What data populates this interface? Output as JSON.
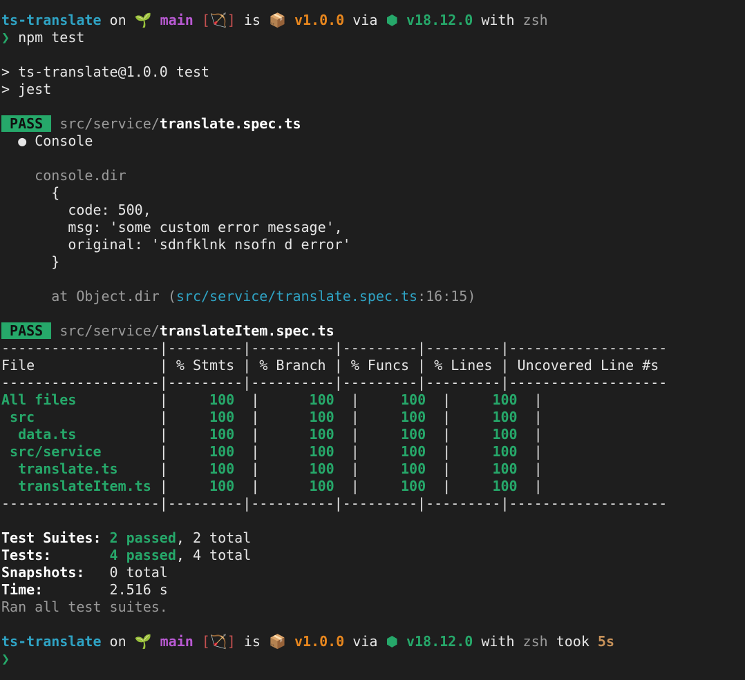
{
  "colors": {
    "background": "#1e1e1e",
    "text": "#e6e6e6",
    "directory": "#2fa3c4",
    "branch": "#b95ad3",
    "git_status": "#c45050",
    "package_version": "#e8871e",
    "node_version": "#26a86a",
    "pass_badge": "#26a86a",
    "dim": "#9a9a9a",
    "duration": "#c9935a"
  },
  "prompt1": {
    "dir": "ts-translate",
    "on": " on ",
    "branch_icon": "🌱",
    "branch": "main",
    "status_open": "[",
    "status_icon": "🏹",
    "status_close": "]",
    "is": " is ",
    "package_icon": "📦",
    "pkg_version": "v1.0.0",
    "via": " via ",
    "node_icon": "⬢",
    "node_version": "v18.12.0",
    "with": " with ",
    "shell": "zsh"
  },
  "command": {
    "caret": "❯",
    "text": "npm test"
  },
  "script_header": [
    "> ts-translate@1.0.0 test",
    "> jest"
  ],
  "suite1": {
    "badge": "PASS",
    "path_dir": "src/service/",
    "path_file": "translate.spec.ts",
    "console_bullet": "●",
    "console_label": "Console",
    "console_method": "console.dir",
    "object_lines": [
      "{",
      "  code: 500,",
      "  msg: 'some custom error message',",
      "  original: 'sdnfklnk nsofn d error'",
      "}"
    ],
    "at_prefix": "at Object.dir (",
    "at_link": "src/service/translate.spec.ts",
    "at_suffix": ":16:15)"
  },
  "suite2": {
    "badge": "PASS",
    "path_dir": "src/service/",
    "path_file": "translateItem.spec.ts"
  },
  "coverage": {
    "separator": "-------------------|---------|----------|---------|---------|-------------------",
    "header": "File               | % Stmts | % Branch | % Funcs | % Lines | Uncovered Line #s ",
    "rows": [
      {
        "file": "All files         ",
        "stmts": "    100 ",
        "branch": "     100 ",
        "funcs": "    100 ",
        "lines": "    100 "
      },
      {
        "file": " src              ",
        "stmts": "    100 ",
        "branch": "     100 ",
        "funcs": "    100 ",
        "lines": "    100 "
      },
      {
        "file": "  data.ts         ",
        "stmts": "    100 ",
        "branch": "     100 ",
        "funcs": "    100 ",
        "lines": "    100 "
      },
      {
        "file": " src/service      ",
        "stmts": "    100 ",
        "branch": "     100 ",
        "funcs": "    100 ",
        "lines": "    100 "
      },
      {
        "file": "  translate.ts    ",
        "stmts": "    100 ",
        "branch": "     100 ",
        "funcs": "    100 ",
        "lines": "    100 "
      },
      {
        "file": "  translateItem.ts",
        "stmts": "    100 ",
        "branch": "     100 ",
        "funcs": "    100 ",
        "lines": "    100 "
      }
    ],
    "pipe": " | ",
    "row_end": " | "
  },
  "summary": {
    "suites_label": "Test Suites: ",
    "suites_passed": "2 passed",
    "suites_total": ", 2 total",
    "tests_label": "Tests:       ",
    "tests_passed": "4 passed",
    "tests_total": ", 4 total",
    "snapshots_label": "Snapshots:   ",
    "snapshots_value": "0 total",
    "time_label": "Time:        ",
    "time_value": "2.516 s",
    "ran": "Ran all test suites."
  },
  "prompt2": {
    "took": " took ",
    "duration": "5s"
  }
}
